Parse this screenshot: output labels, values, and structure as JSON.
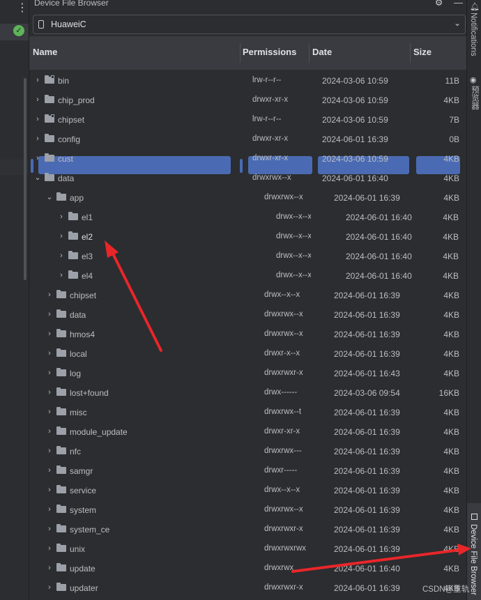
{
  "window": {
    "panel_title": "Device File Browser",
    "gear_icon": "gear-icon",
    "minimize_icon": "minimize-icon"
  },
  "device": {
    "selected": "HuaweiC",
    "icon": "phone-icon"
  },
  "columns": [
    "Name",
    "Permissions",
    "Date",
    "Size"
  ],
  "rows": [
    {
      "depth": 0,
      "expanded": false,
      "link": true,
      "name": "bin",
      "perm": "lrw-r--r--",
      "date": "2024-03-06 10:59",
      "size": "11B"
    },
    {
      "depth": 0,
      "expanded": false,
      "link": false,
      "name": "chip_prod",
      "perm": "drwxr-xr-x",
      "date": "2024-03-06 10:59",
      "size": "4KB"
    },
    {
      "depth": 0,
      "expanded": false,
      "link": true,
      "name": "chipset",
      "perm": "lrw-r--r--",
      "date": "2024-03-06 10:59",
      "size": "7B"
    },
    {
      "depth": 0,
      "expanded": false,
      "link": false,
      "name": "config",
      "perm": "drwxr-xr-x",
      "date": "2024-06-01 16:39",
      "size": "0B"
    },
    {
      "depth": 0,
      "expanded": false,
      "link": false,
      "name": "cust",
      "perm": "drwxr-xr-x",
      "date": "2024-03-06 10:59",
      "size": "4KB"
    },
    {
      "depth": 0,
      "expanded": true,
      "link": false,
      "name": "data",
      "perm": "drwxrwx--x",
      "date": "2024-06-01 16:40",
      "size": "4KB"
    },
    {
      "depth": 1,
      "expanded": true,
      "link": false,
      "name": "app",
      "perm": "drwxrwx--x",
      "date": "2024-06-01 16:39",
      "size": "4KB"
    },
    {
      "depth": 2,
      "expanded": false,
      "link": false,
      "name": "el1",
      "perm": "drwx--x--x",
      "date": "2024-06-01 16:40",
      "size": "4KB"
    },
    {
      "depth": 2,
      "expanded": false,
      "link": false,
      "name": "el2",
      "perm": "drwx--x--x",
      "date": "2024-06-01 16:40",
      "size": "4KB",
      "selected": true
    },
    {
      "depth": 2,
      "expanded": false,
      "link": false,
      "name": "el3",
      "perm": "drwx--x--x",
      "date": "2024-06-01 16:40",
      "size": "4KB"
    },
    {
      "depth": 2,
      "expanded": false,
      "link": false,
      "name": "el4",
      "perm": "drwx--x--x",
      "date": "2024-06-01 16:40",
      "size": "4KB"
    },
    {
      "depth": 1,
      "expanded": false,
      "link": false,
      "name": "chipset",
      "perm": "drwx--x--x",
      "date": "2024-06-01 16:39",
      "size": "4KB"
    },
    {
      "depth": 1,
      "expanded": false,
      "link": false,
      "name": "data",
      "perm": "drwxrwx--x",
      "date": "2024-06-01 16:39",
      "size": "4KB"
    },
    {
      "depth": 1,
      "expanded": false,
      "link": false,
      "name": "hmos4",
      "perm": "drwxrwx--x",
      "date": "2024-06-01 16:39",
      "size": "4KB"
    },
    {
      "depth": 1,
      "expanded": false,
      "link": false,
      "name": "local",
      "perm": "drwxr-x--x",
      "date": "2024-06-01 16:39",
      "size": "4KB"
    },
    {
      "depth": 1,
      "expanded": false,
      "link": false,
      "name": "log",
      "perm": "drwxrwxr-x",
      "date": "2024-06-01 16:43",
      "size": "4KB"
    },
    {
      "depth": 1,
      "expanded": false,
      "link": false,
      "name": "lost+found",
      "perm": "drwx------",
      "date": "2024-03-06 09:54",
      "size": "16KB"
    },
    {
      "depth": 1,
      "expanded": false,
      "link": false,
      "name": "misc",
      "perm": "drwxrwx--t",
      "date": "2024-06-01 16:39",
      "size": "4KB"
    },
    {
      "depth": 1,
      "expanded": false,
      "link": false,
      "name": "module_update",
      "perm": "drwxr-xr-x",
      "date": "2024-06-01 16:39",
      "size": "4KB"
    },
    {
      "depth": 1,
      "expanded": false,
      "link": false,
      "name": "nfc",
      "perm": "drwxrwx---",
      "date": "2024-06-01 16:39",
      "size": "4KB"
    },
    {
      "depth": 1,
      "expanded": false,
      "link": false,
      "name": "samgr",
      "perm": "drwxr-----",
      "date": "2024-06-01 16:39",
      "size": "4KB"
    },
    {
      "depth": 1,
      "expanded": false,
      "link": false,
      "name": "service",
      "perm": "drwx--x--x",
      "date": "2024-06-01 16:39",
      "size": "4KB"
    },
    {
      "depth": 1,
      "expanded": false,
      "link": false,
      "name": "system",
      "perm": "drwxrwx--x",
      "date": "2024-06-01 16:39",
      "size": "4KB"
    },
    {
      "depth": 1,
      "expanded": false,
      "link": false,
      "name": "system_ce",
      "perm": "drwxrwxr-x",
      "date": "2024-06-01 16:39",
      "size": "4KB"
    },
    {
      "depth": 1,
      "expanded": false,
      "link": false,
      "name": "unix",
      "perm": "drwxrwxrwx",
      "date": "2024-06-01 16:39",
      "size": "4KB"
    },
    {
      "depth": 1,
      "expanded": false,
      "link": false,
      "name": "update",
      "perm": "drwxrwx",
      "date": "2024-06-01 16:40",
      "size": "4KB"
    },
    {
      "depth": 1,
      "expanded": false,
      "link": false,
      "name": "updater",
      "perm": "drwxrwxr-x",
      "date": "2024-06-01 16:39",
      "size": "4KB"
    }
  ],
  "right_bar": {
    "notifications": "Notifications",
    "preview": "预览器",
    "device_file_browser": "Device File Browser"
  },
  "watermark": "CSDN@重轨",
  "colors": {
    "background": "#2b2d30",
    "header": "#393b40",
    "selection": "#4a6bb3",
    "arrow": "#e8262a",
    "success": "#5fb35a"
  }
}
